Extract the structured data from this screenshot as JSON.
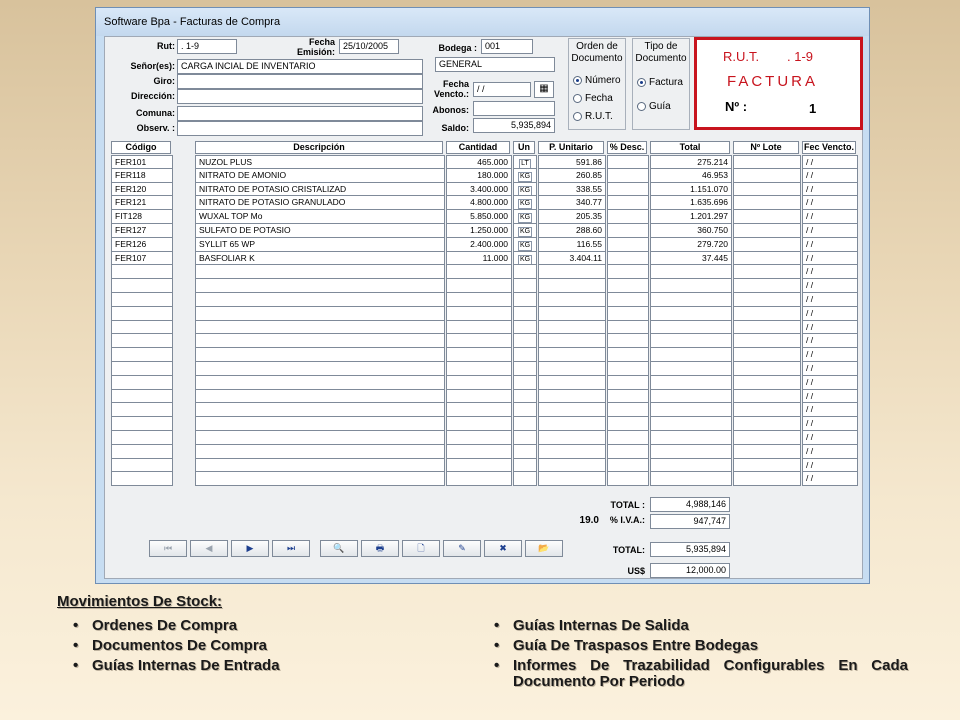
{
  "window": {
    "title": "Software Bpa - Facturas de Compra"
  },
  "header": {
    "rut_label": "Rut:",
    "rut_value": ". 1-9",
    "fecha_emision_label1": "Fecha",
    "fecha_emision_label2": "Emisión:",
    "fecha_emision_value": "25/10/2005",
    "bodega_label": "Bodega :",
    "bodega_value": "001",
    "bodega_nombre": "GENERAL",
    "senores_label": "Señor(es):",
    "senores_value": "CARGA INCIAL DE INVENTARIO",
    "giro_label": "Giro:",
    "giro_value": "",
    "direccion_label": "Dirección:",
    "direccion_value": "",
    "comuna_label": "Comuna:",
    "comuna_value": "",
    "observ_label": "Observ. :",
    "observ_value": "",
    "fecha_vencto_label1": "Fecha",
    "fecha_vencto_label2": "Vencto.:",
    "fecha_vencto_value": "/ /",
    "abonos_label": "Abonos:",
    "abonos_value": "",
    "saldo_label": "Saldo:",
    "saldo_value": "5,935,894"
  },
  "orden": {
    "title1": "Orden de",
    "title2": "Documento",
    "options": [
      "Número",
      "Fecha",
      "R.U.T."
    ],
    "selected": 0
  },
  "tipo": {
    "title1": "Tipo de",
    "title2": "Documento",
    "options": [
      "Factura",
      "Guía"
    ],
    "selected": 0
  },
  "factura_box": {
    "rut_label": "R.U.T.",
    "rut_value": ". 1-9",
    "title": "FACTURA",
    "nro_label": "Nº :",
    "nro_value": "1"
  },
  "table": {
    "columns": [
      "Código",
      "Descripción",
      "Cantidad",
      "Un",
      "P. Unitario",
      "% Desc.",
      "Total",
      "Nº Lote",
      "Fec Vencto."
    ],
    "rows": [
      {
        "codigo": "FER101",
        "descripcion": "NUZOL PLUS",
        "cantidad": "465.000",
        "un": "LT",
        "unitario": "591.86",
        "desc": "",
        "total": "275.214",
        "lote": "",
        "vencto": "/ /"
      },
      {
        "codigo": "FER118",
        "descripcion": "NITRATO DE AMONIO",
        "cantidad": "180.000",
        "un": "KG",
        "unitario": "260.85",
        "desc": "",
        "total": "46.953",
        "lote": "",
        "vencto": "/ /"
      },
      {
        "codigo": "FER120",
        "descripcion": "NITRATO DE POTASIO CRISTALIZAD",
        "cantidad": "3.400.000",
        "un": "KG",
        "unitario": "338.55",
        "desc": "",
        "total": "1.151.070",
        "lote": "",
        "vencto": "/ /"
      },
      {
        "codigo": "FER121",
        "descripcion": "NITRATO DE POTASIO GRANULADO",
        "cantidad": "4.800.000",
        "un": "KG",
        "unitario": "340.77",
        "desc": "",
        "total": "1.635.696",
        "lote": "",
        "vencto": "/ /"
      },
      {
        "codigo": "FIT128",
        "descripcion": "WUXAL TOP Mo",
        "cantidad": "5.850.000",
        "un": "KG",
        "unitario": "205.35",
        "desc": "",
        "total": "1.201.297",
        "lote": "",
        "vencto": "/ /"
      },
      {
        "codigo": "FER127",
        "descripcion": "SULFATO DE POTASIO",
        "cantidad": "1.250.000",
        "un": "KG",
        "unitario": "288.60",
        "desc": "",
        "total": "360.750",
        "lote": "",
        "vencto": "/ /"
      },
      {
        "codigo": "FER126",
        "descripcion": "SYLLIT 65 WP",
        "cantidad": "2.400.000",
        "un": "KG",
        "unitario": "116.55",
        "desc": "",
        "total": "279.720",
        "lote": "",
        "vencto": "/ /"
      },
      {
        "codigo": "FER107",
        "descripcion": "BASFOLIAR K",
        "cantidad": "11.000",
        "un": "KG",
        "unitario": "3.404.11",
        "desc": "",
        "total": "37.445",
        "lote": "",
        "vencto": "/ /"
      }
    ],
    "empty_rows": 16,
    "empty_vencto": "/ /"
  },
  "totals": {
    "total_label": "TOTAL :",
    "total_value": "4,988,146",
    "iva_rate": "19.0",
    "iva_label": "% I.V.A.:",
    "iva_value": "947,747",
    "grand_label": "TOTAL:",
    "grand_value": "5,935,894",
    "usd_label": "US$",
    "usd_value": "12,000.00"
  },
  "toolbar": {
    "buttons": [
      {
        "name": "first-record-button",
        "icon": "first-icon",
        "glyph": "⏮"
      },
      {
        "name": "prev-record-button",
        "icon": "prev-icon",
        "glyph": "◀"
      },
      {
        "name": "next-record-button",
        "icon": "next-icon",
        "glyph": "▶"
      },
      {
        "name": "last-record-button",
        "icon": "last-icon",
        "glyph": "⏭"
      },
      {
        "name": "search-button",
        "icon": "binoculars-icon",
        "glyph": "🔍"
      },
      {
        "name": "print-button",
        "icon": "printer-icon",
        "glyph": "🖶"
      },
      {
        "name": "new-button",
        "icon": "new-document-icon",
        "glyph": "🗋"
      },
      {
        "name": "edit-button",
        "icon": "edit-icon",
        "glyph": "✎"
      },
      {
        "name": "delete-button",
        "icon": "delete-icon",
        "glyph": "✖"
      },
      {
        "name": "open-button",
        "icon": "folder-icon",
        "glyph": "📂"
      }
    ]
  },
  "slide": {
    "section_title": "Movimientos De Stock:",
    "left_items": [
      "Ordenes De Compra",
      "Documentos De Compra",
      "Guías Internas De Entrada"
    ],
    "right_items": [
      "Guías Internas De Salida",
      "Guía De Traspasos Entre Bodegas",
      "Informes De Trazabilidad Configurables En Cada Documento Por Periodo"
    ]
  }
}
